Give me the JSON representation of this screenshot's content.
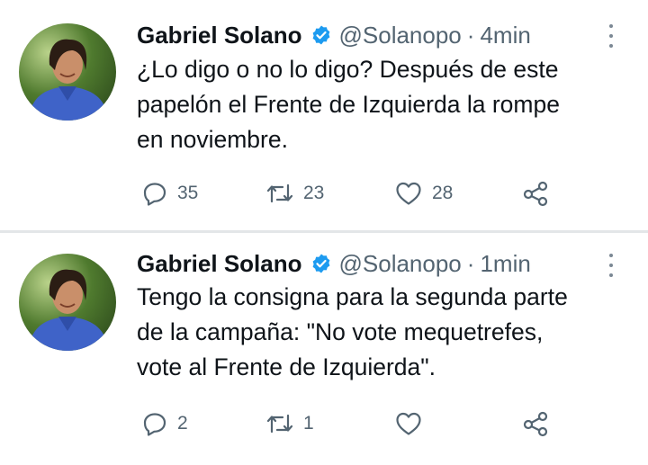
{
  "tweets": [
    {
      "author_name": "Gabriel Solano",
      "handle": "@Solanopo",
      "time": "4min",
      "separator": "·",
      "text": "¿Lo digo o no lo digo? Después de este\npapelón el Frente de Izquierda la rompe\nen noviembre.",
      "replies": "35",
      "retweets": "23",
      "likes": "28"
    },
    {
      "author_name": "Gabriel Solano",
      "handle": "@Solanopo",
      "time": "1min",
      "separator": "·",
      "text": "Tengo la consigna para la segunda parte\nde la campaña: \"No vote mequetrefes,\nvote al Frente de Izquierda\".",
      "replies": "2",
      "retweets": "1",
      "likes": ""
    }
  ],
  "icons": {
    "verified": "verified-badge-icon",
    "reply": "reply-bubble-icon",
    "retweet": "retweet-arrows-icon",
    "like": "heart-icon",
    "share": "share-nodes-icon",
    "more": "vertical-dots-icon"
  },
  "colors": {
    "verified": "#1d9bf0",
    "text": "#0f1419",
    "secondary": "#536471",
    "divider": "#e3e6e8"
  }
}
